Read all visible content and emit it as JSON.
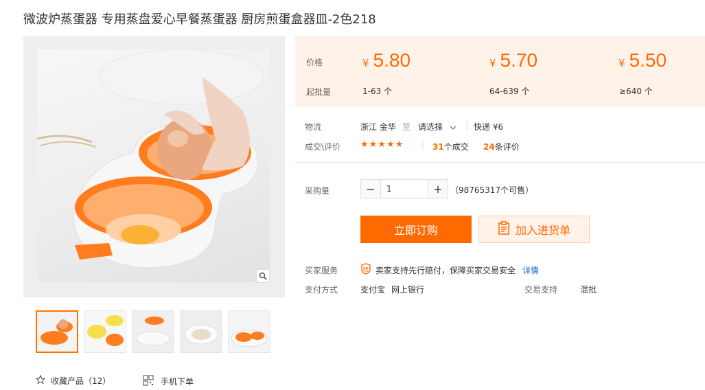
{
  "product": {
    "title": "微波炉蒸蛋器 专用蒸盘爱心早餐蒸蛋器 厨房煎蛋盒器皿-2色218"
  },
  "price_box": {
    "price_label": "价格",
    "moq_label": "起批量",
    "tiers": [
      {
        "currency": "¥",
        "price": "5.80",
        "range": "1-63 个"
      },
      {
        "currency": "¥",
        "price": "5.70",
        "range": "64-639 个"
      },
      {
        "currency": "¥",
        "price": "5.50",
        "range": "≥640 个"
      }
    ]
  },
  "logistics": {
    "label": "物流",
    "origin": "浙江 金华",
    "to": "至",
    "destination": "请选择",
    "shipping": "快递 ¥6"
  },
  "deals": {
    "label": "成交\\评价",
    "stars": "★★★★★",
    "deal_count": "31",
    "deal_suffix": "个成交",
    "review_count": "24",
    "review_suffix": "条评价"
  },
  "purchase": {
    "label": "采购量",
    "minus": "−",
    "quantity": "1",
    "plus": "+",
    "stock": "（98765317个可售）"
  },
  "actions": {
    "buy_now": "立即订购",
    "add_to_list": "加入进货单"
  },
  "service": {
    "label": "买家服务",
    "text": "卖家支持先行赔付，保障买家交易安全",
    "link": "详情"
  },
  "payment": {
    "label": "支付方式",
    "methods": [
      "支付宝",
      "网上银行"
    ],
    "trade_label": "交易支持",
    "trade_value": "混批"
  },
  "footer": {
    "favorite": "收藏产品（12）",
    "mobile_order": "手机下单"
  },
  "colors": {
    "accent": "#ff6a00",
    "price_bg": "#fff2e8",
    "link": "#1664c1"
  }
}
